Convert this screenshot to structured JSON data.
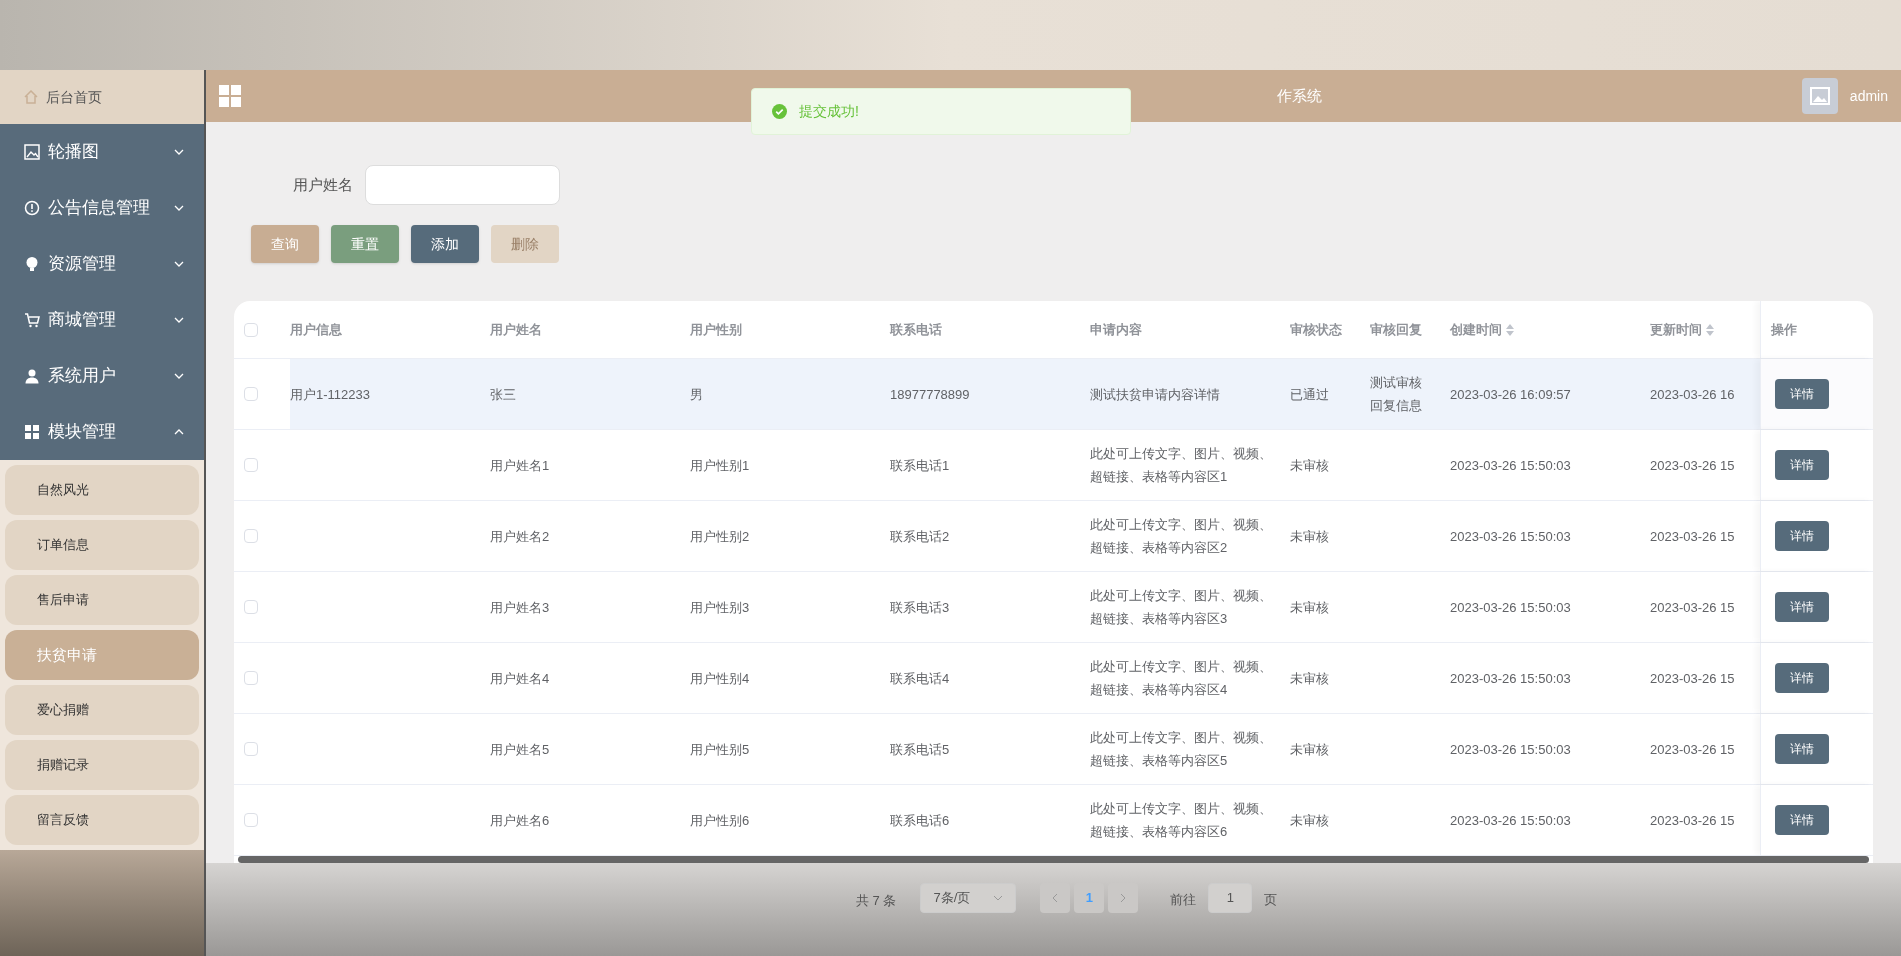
{
  "header": {
    "home": "后台首页",
    "title_visible": "作系统",
    "user": "admin"
  },
  "toast": {
    "message": "提交成功!"
  },
  "sidebar": {
    "items": [
      {
        "label": "轮播图",
        "expanded": false
      },
      {
        "label": "公告信息管理",
        "expanded": false
      },
      {
        "label": "资源管理",
        "expanded": false
      },
      {
        "label": "商城管理",
        "expanded": false
      },
      {
        "label": "系统用户",
        "expanded": false
      },
      {
        "label": "模块管理",
        "expanded": true,
        "children": [
          {
            "label": "自然风光",
            "selected": false
          },
          {
            "label": "订单信息",
            "selected": false
          },
          {
            "label": "售后申请",
            "selected": false
          },
          {
            "label": "扶贫申请",
            "selected": true
          },
          {
            "label": "爱心捐赠",
            "selected": false
          },
          {
            "label": "捐赠记录",
            "selected": false
          },
          {
            "label": "留言反馈",
            "selected": false
          }
        ]
      }
    ]
  },
  "search": {
    "label": "用户姓名"
  },
  "buttons": [
    {
      "label": "查询",
      "kind": "query",
      "disabled": false
    },
    {
      "label": "重置",
      "kind": "reset",
      "disabled": false
    },
    {
      "label": "添加",
      "kind": "add",
      "disabled": false
    },
    {
      "label": "删除",
      "kind": "delete",
      "disabled": true
    }
  ],
  "table": {
    "all_checked": false,
    "columns": [
      {
        "label": "用户信息",
        "sortable": false
      },
      {
        "label": "用户姓名",
        "sortable": false
      },
      {
        "label": "用户性别",
        "sortable": false
      },
      {
        "label": "联系电话",
        "sortable": false
      },
      {
        "label": "申请内容",
        "sortable": false
      },
      {
        "label": "审核状态",
        "sortable": false
      },
      {
        "label": "审核回复",
        "sortable": false
      },
      {
        "label": "创建时间",
        "sortable": true
      },
      {
        "label": "更新时间",
        "sortable": true
      },
      {
        "label": "操作",
        "sortable": false
      }
    ],
    "rows": [
      {
        "highlighted": true,
        "checked": false,
        "cells": [
          "用户1-112233",
          "张三",
          "男",
          "18977778899",
          "测试扶贫申请内容详情",
          "已通过",
          "测试审核回复信息",
          "2023-03-26 16:09:57",
          "2023-03-26 16"
        ],
        "action": "详情"
      },
      {
        "highlighted": false,
        "checked": false,
        "cells": [
          "",
          "用户姓名1",
          "用户性别1",
          "联系电话1",
          "此处可上传文字、图片、视频、超链接、表格等内容区1",
          "未审核",
          "",
          "2023-03-26 15:50:03",
          "2023-03-26 15"
        ],
        "action": "详情"
      },
      {
        "highlighted": false,
        "checked": false,
        "cells": [
          "",
          "用户姓名2",
          "用户性别2",
          "联系电话2",
          "此处可上传文字、图片、视频、超链接、表格等内容区2",
          "未审核",
          "",
          "2023-03-26 15:50:03",
          "2023-03-26 15"
        ],
        "action": "详情"
      },
      {
        "highlighted": false,
        "checked": false,
        "cells": [
          "",
          "用户姓名3",
          "用户性别3",
          "联系电话3",
          "此处可上传文字、图片、视频、超链接、表格等内容区3",
          "未审核",
          "",
          "2023-03-26 15:50:03",
          "2023-03-26 15"
        ],
        "action": "详情"
      },
      {
        "highlighted": false,
        "checked": false,
        "cells": [
          "",
          "用户姓名4",
          "用户性别4",
          "联系电话4",
          "此处可上传文字、图片、视频、超链接、表格等内容区4",
          "未审核",
          "",
          "2023-03-26 15:50:03",
          "2023-03-26 15"
        ],
        "action": "详情"
      },
      {
        "highlighted": false,
        "checked": false,
        "cells": [
          "",
          "用户姓名5",
          "用户性别5",
          "联系电话5",
          "此处可上传文字、图片、视频、超链接、表格等内容区5",
          "未审核",
          "",
          "2023-03-26 15:50:03",
          "2023-03-26 15"
        ],
        "action": "详情"
      },
      {
        "highlighted": false,
        "checked": false,
        "cells": [
          "",
          "用户姓名6",
          "用户性别6",
          "联系电话6",
          "此处可上传文字、图片、视频、超链接、表格等内容区6",
          "未审核",
          "",
          "2023-03-26 15:50:03",
          "2023-03-26 15"
        ],
        "action": "详情"
      }
    ]
  },
  "pagination": {
    "total": "共 7 条",
    "page_size": "7条/页",
    "pages": [
      {
        "label": "1",
        "selected": true
      }
    ],
    "goto_label": "前往",
    "goto_value": "1",
    "goto_suffix": "页"
  }
}
